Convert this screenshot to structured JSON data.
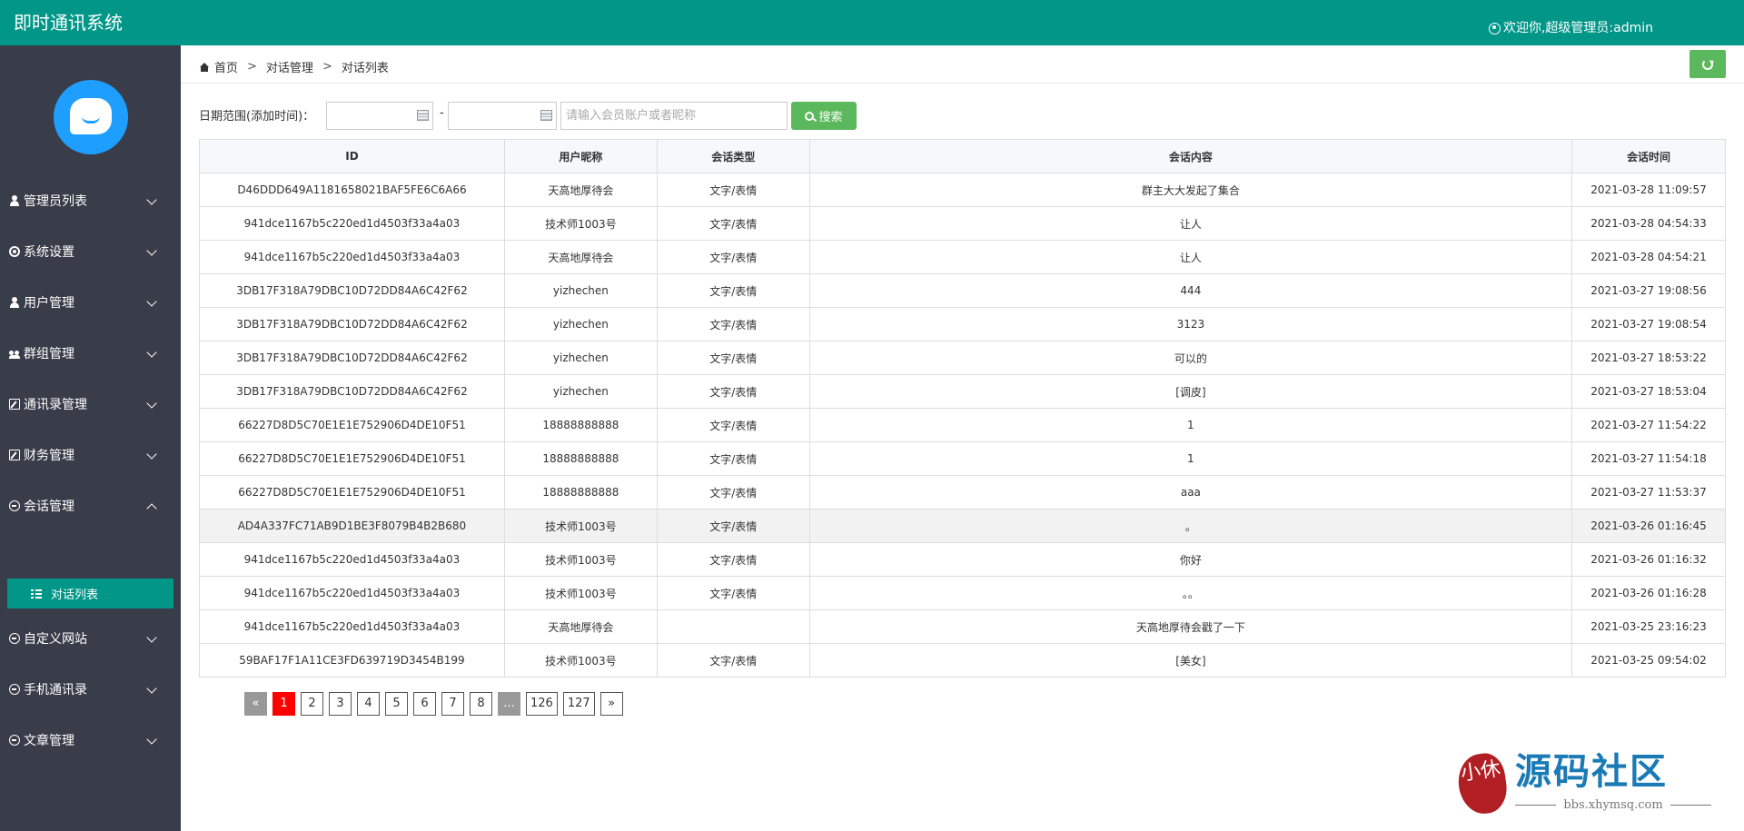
{
  "app": {
    "title": "即时通讯系统",
    "welcome": "欢迎你,超级管理员:admin"
  },
  "sidebar": {
    "items": [
      {
        "label": "管理员列表",
        "icon": "person-icon"
      },
      {
        "label": "系统设置",
        "icon": "gear-icon"
      },
      {
        "label": "用户管理",
        "icon": "person-icon"
      },
      {
        "label": "群组管理",
        "icon": "group-icon"
      },
      {
        "label": "通讯录管理",
        "icon": "edit-icon"
      },
      {
        "label": "财务管理",
        "icon": "edit-icon"
      },
      {
        "label": "会话管理",
        "icon": "chat-icon",
        "expanded": true
      },
      {
        "label": "自定义网站",
        "icon": "chat-icon"
      },
      {
        "label": "手机通讯录",
        "icon": "chat-icon"
      },
      {
        "label": "文章管理",
        "icon": "chat-icon"
      }
    ],
    "active_sub": {
      "label": "对话列表",
      "icon": "list-icon"
    }
  },
  "breadcrumb": {
    "home": "首页",
    "level1": "对话管理",
    "level2": "对话列表",
    "separator": ">"
  },
  "filter": {
    "label": "日期范围(添加时间)：",
    "start_date": "",
    "end_date": "",
    "dash": "-",
    "keyword_placeholder": "请输入会员账户或者昵称",
    "keyword_value": "",
    "search_label": "搜索"
  },
  "table": {
    "columns": [
      "ID",
      "用户昵称",
      "会话类型",
      "会话内容",
      "会话时间"
    ],
    "rows": [
      [
        "D46DDD649A1181658021BAF5FE6C6A66",
        "天高地厚待会",
        "文字/表情",
        "群主大大发起了集合",
        "2021-03-28 11:09:57"
      ],
      [
        "941dce1167b5c220ed1d4503f33a4a03",
        "技术师1003号",
        "文字/表情",
        "让人",
        "2021-03-28 04:54:33"
      ],
      [
        "941dce1167b5c220ed1d4503f33a4a03",
        "天高地厚待会",
        "文字/表情",
        "让人",
        "2021-03-28 04:54:21"
      ],
      [
        "3DB17F318A79DBC10D72DD84A6C42F62",
        "yizhechen",
        "文字/表情",
        "444",
        "2021-03-27 19:08:56"
      ],
      [
        "3DB17F318A79DBC10D72DD84A6C42F62",
        "yizhechen",
        "文字/表情",
        "3123",
        "2021-03-27 19:08:54"
      ],
      [
        "3DB17F318A79DBC10D72DD84A6C42F62",
        "yizhechen",
        "文字/表情",
        "可以的",
        "2021-03-27 18:53:22"
      ],
      [
        "3DB17F318A79DBC10D72DD84A6C42F62",
        "yizhechen",
        "文字/表情",
        "[调皮]",
        "2021-03-27 18:53:04"
      ],
      [
        "66227D8D5C70E1E1E752906D4DE10F51",
        "18888888888",
        "文字/表情",
        "1",
        "2021-03-27 11:54:22"
      ],
      [
        "66227D8D5C70E1E1E752906D4DE10F51",
        "18888888888",
        "文字/表情",
        "1",
        "2021-03-27 11:54:18"
      ],
      [
        "66227D8D5C70E1E1E752906D4DE10F51",
        "18888888888",
        "文字/表情",
        "aaa",
        "2021-03-27 11:53:37"
      ],
      [
        "AD4A337FC71AB9D1BE3F8079B4B2B680",
        "技术师1003号",
        "文字/表情",
        "。",
        "2021-03-26 01:16:45"
      ],
      [
        "941dce1167b5c220ed1d4503f33a4a03",
        "技术师1003号",
        "文字/表情",
        "你好",
        "2021-03-26 01:16:32"
      ],
      [
        "941dce1167b5c220ed1d4503f33a4a03",
        "技术师1003号",
        "文字/表情",
        "。。",
        "2021-03-26 01:16:28"
      ],
      [
        "941dce1167b5c220ed1d4503f33a4a03",
        "天高地厚待会",
        "",
        "天高地厚待会戳了一下",
        "2021-03-25 23:16:23"
      ],
      [
        "59BAF17F1A11CE3FD639719D3454B199",
        "技术师1003号",
        "文字/表情",
        "[美女]",
        "2021-03-25 09:54:02"
      ]
    ],
    "highlighted_row": 10
  },
  "pagination": {
    "prev": "«",
    "pages": [
      "1",
      "2",
      "3",
      "4",
      "5",
      "6",
      "7",
      "8"
    ],
    "ellipsis": "...",
    "tail": [
      "126",
      "127"
    ],
    "next": "»",
    "current": "1"
  },
  "watermark": {
    "seal_text": "小休",
    "title": "源码社区",
    "url": "bbs.xhymsq.com"
  },
  "colors": {
    "header": "#009688",
    "sidebar": "#393d49",
    "active": "#009688",
    "button_green": "#5cb85c",
    "page_active": "#ff0000",
    "avatar": "#1e9fff"
  }
}
